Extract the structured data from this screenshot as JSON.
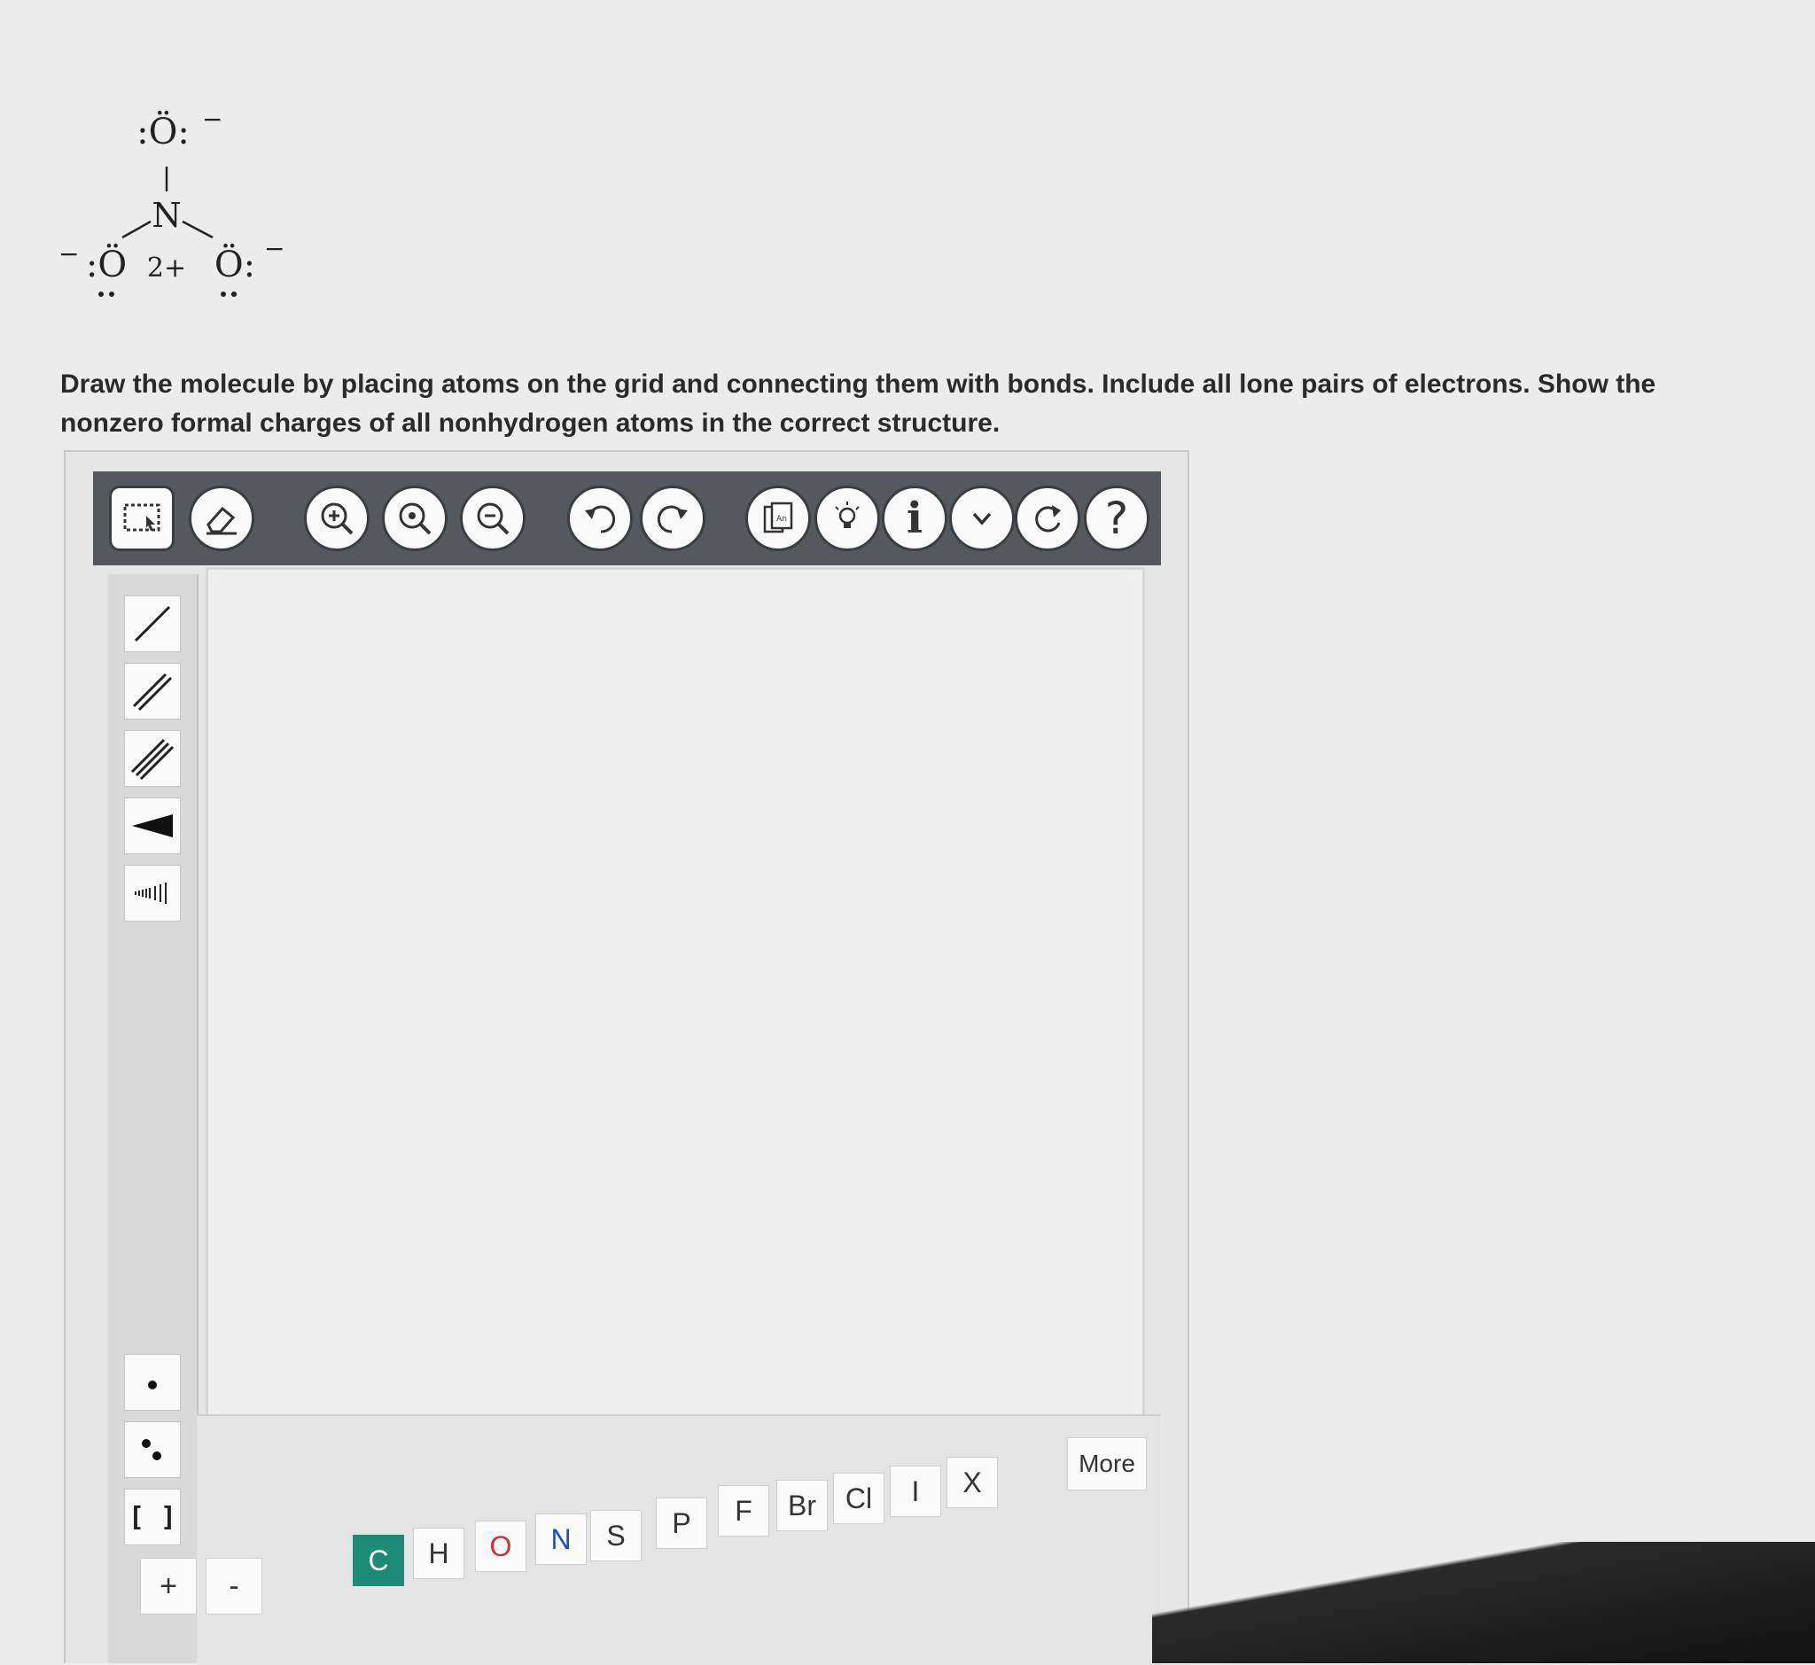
{
  "question": {
    "prompt": "Draw the molecule by placing atoms on the grid and connecting them with bonds. Include all lone pairs of electrons. Show the nonzero formal charges of all nonhydrogen atoms in the correct structure.",
    "molecule": {
      "central_atom": "N",
      "central_charge": "2+",
      "top_atom": ":Ö:",
      "top_charge": "−",
      "left_atom": ":Ö",
      "left_charge": "−",
      "right_atom": "Ö:",
      "right_charge": "−"
    }
  },
  "toolbar": {
    "buttons": [
      "select-tool",
      "eraser-tool",
      "zoom-in",
      "zoom-reset",
      "zoom-out",
      "undo",
      "redo",
      "templates",
      "hint",
      "info",
      "dropdown",
      "refresh",
      "help"
    ],
    "help_label": "?",
    "info_label": "i"
  },
  "sidebar": {
    "bonds": [
      "single-bond",
      "double-bond",
      "triple-bond",
      "wedge-bond",
      "hash-bond"
    ],
    "electrons": [
      "single-electron",
      "lone-pair"
    ],
    "bracket_label": "[ ]"
  },
  "atoms": {
    "row1": [
      "Br",
      "Cl",
      "I",
      "X"
    ],
    "row1_pre": [
      "S",
      "P",
      "F"
    ],
    "row2": [
      "C",
      "H",
      "O",
      "N"
    ],
    "selected": "C",
    "more_label": "More"
  },
  "charges": {
    "plus_label": "+",
    "minus_label": "-"
  }
}
